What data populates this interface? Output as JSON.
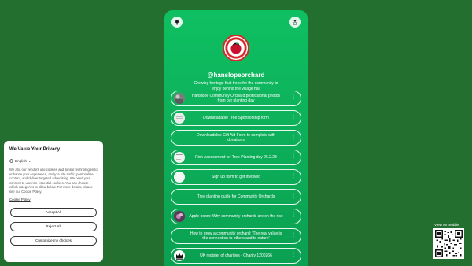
{
  "profile": {
    "handle": "@hanslopeorchard",
    "bio": "Growing heritage fruit trees for the community to enjoy behind the village hall",
    "logo_text": "HANSLOPE COMMUNITY ORCHARD"
  },
  "links": [
    {
      "label": "Hanslope Community Orchard professional photos from our planting day",
      "thumb": "photo"
    },
    {
      "label": "Downloadable Tree Sponsorship form",
      "thumb": "doc"
    },
    {
      "label": "Downloadable Gift Aid Form to complete with donations",
      "thumb": ""
    },
    {
      "label": "Risk Assessment for Tree Planting day 26.2.23",
      "thumb": "doc"
    },
    {
      "label": "Sign up form to get involved",
      "thumb": "blank"
    },
    {
      "label": "Tree planting guide for Community Orchards",
      "thumb": ""
    },
    {
      "label": "Apple boom: Why community orchards are on the rise",
      "thumb": "apple"
    },
    {
      "label": "How to grow a community orchard: 'The real value is the connection to others and to nature'",
      "thumb": ""
    },
    {
      "label": "UK register of charities - Charity 1200266",
      "thumb": "crown"
    }
  ],
  "cookie": {
    "title": "We Value Your Privacy",
    "language": "English",
    "text": "We and our vendors use cookies and similar technologies to enhance your experience, analyze site traffic, personalize content, and deliver targeted advertising. We need your consent to use non-essential cookies. You can choose which categories to allow below. For more details, please see our Cookie Policy.",
    "policy_link": "Cookie Policy",
    "accept_all": "Accept All",
    "reject_all": "Reject All",
    "customize": "Customize my choices"
  },
  "qr": {
    "label": "View on mobile"
  },
  "icons": {
    "left_button": "pin-icon",
    "right_button": "share-icon",
    "link_more": "more-icon"
  },
  "colors": {
    "page_background": "#236f30",
    "card_gradient_top": "#0fc062",
    "card_gradient_bottom": "#0a9f51"
  }
}
